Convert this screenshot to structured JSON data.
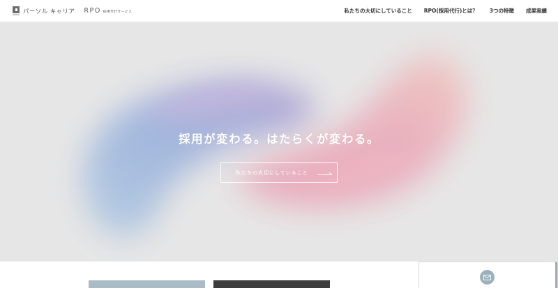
{
  "header": {
    "logo_text": "パーソル キャリア",
    "rpo_label": "RPO",
    "rpo_sub": "採用代行サービス",
    "nav": [
      {
        "label": "私たちの大切にしていること"
      },
      {
        "label": "RPO(採用代行)とは？"
      },
      {
        "label": "3つの特徴"
      },
      {
        "label": "成果実績"
      }
    ]
  },
  "hero": {
    "title": "採用が変わる。はたらくが変わる。",
    "button_label": "私たちの大切にしていること"
  },
  "colors": {
    "hero_bg": "#e6e6e6",
    "blob_blue": "#9fb9de",
    "blob_purple": "#b3a3d3",
    "blob_pink": "#e7a3b5",
    "accent_slate": "#9bb1bd"
  },
  "icons": {
    "logo": "persol-logo-icon",
    "arrow": "arrow-right-icon",
    "mail": "mail-icon"
  }
}
